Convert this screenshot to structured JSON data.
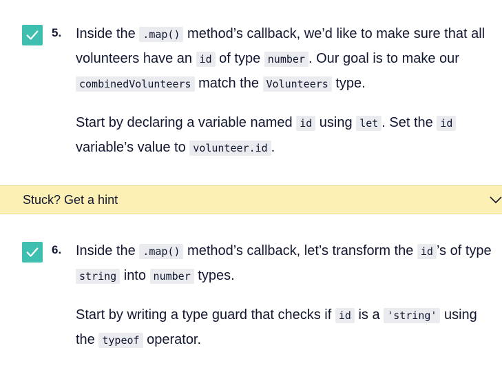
{
  "tasks": [
    {
      "number": "5.",
      "checked": true,
      "para1": {
        "t1": "Inside the ",
        "c1": ".map()",
        "t2": " method’s callback, we’d like to make sure that all volunteers have an ",
        "c2": "id",
        "t3": " of type ",
        "c3": "number",
        "t4": ". Our goal is to make our ",
        "c4": "combinedVolunteers",
        "t5": " match the ",
        "c5": "Volunteers",
        "t6": " type."
      },
      "para2": {
        "t1": "Start by declaring a variable named ",
        "c1": "id",
        "t2": " using ",
        "c2": "let",
        "t3": ". Set the ",
        "c3": "id",
        "t4": " variable’s value to ",
        "c4": "volunteer.id",
        "t5": "."
      }
    },
    {
      "number": "6.",
      "checked": true,
      "para1": {
        "t1": "Inside the ",
        "c1": ".map()",
        "t2": " method’s callback, let’s transform the ",
        "c2": "id",
        "t3": "’s of type ",
        "c3": "string",
        "t4": " into ",
        "c4": "number",
        "t5": " types."
      },
      "para2": {
        "t1": "Start by writing a type guard that checks if ",
        "c1": "id",
        "t2": " is a ",
        "c2": "'string'",
        "t3": " using the ",
        "c3": "typeof",
        "t4": " operator."
      }
    }
  ],
  "hint": {
    "label": "Stuck? Get a hint",
    "icon": "chevron-down-icon"
  },
  "colors": {
    "check": "#3fbfb0",
    "hint_bg": "#fdf0b4",
    "code_bg": "#e9ebef",
    "text": "#10162f"
  }
}
